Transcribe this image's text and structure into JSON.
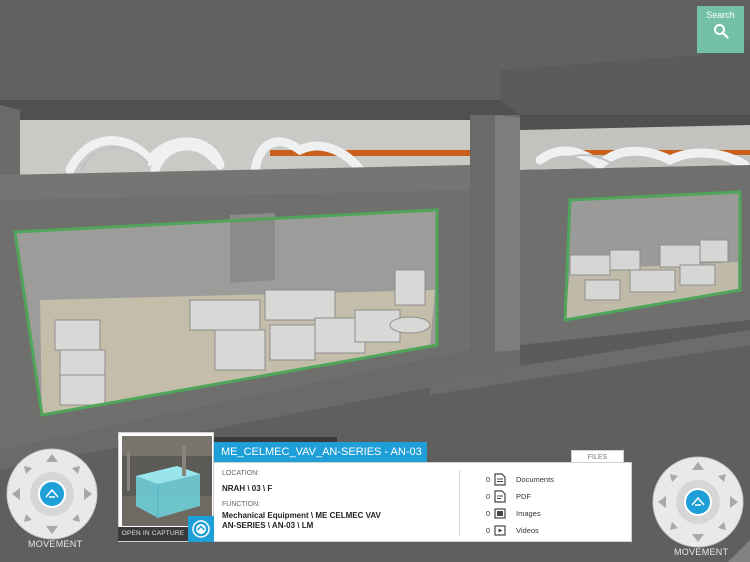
{
  "search": {
    "label": "Search",
    "icon": "search-icon"
  },
  "movement_left": {
    "label": "MOVEMENT"
  },
  "movement_right": {
    "label": "MOVEMENT"
  },
  "asset": {
    "title": "ME_CELMEC_VAV_AN-SERIES - AN-03",
    "open_capture_label": "OPEN IN CAPTURE",
    "files_tab_label": "FILES",
    "location_label": "LOCATION:",
    "location_value": "NRAH \\ 03 \\ F",
    "function_label": "FUNCTION:",
    "function_line1": "Mechanical Equipment \\ ME CELMEC VAV",
    "function_line2": "AN-SERIES \\ AN-03 \\ LM"
  },
  "files": [
    {
      "count": "0",
      "label": "Documents",
      "icon": "document-icon"
    },
    {
      "count": "0",
      "label": "PDF",
      "icon": "pdf-icon"
    },
    {
      "count": "0",
      "label": "Images",
      "icon": "image-icon"
    },
    {
      "count": "0",
      "label": "Videos",
      "icon": "video-icon"
    }
  ],
  "colors": {
    "accent_blue": "#1e9fd8",
    "search_green": "#74c1a6",
    "glass_frame_green": "#4fa55a",
    "duct_orange": "#c8601c"
  }
}
